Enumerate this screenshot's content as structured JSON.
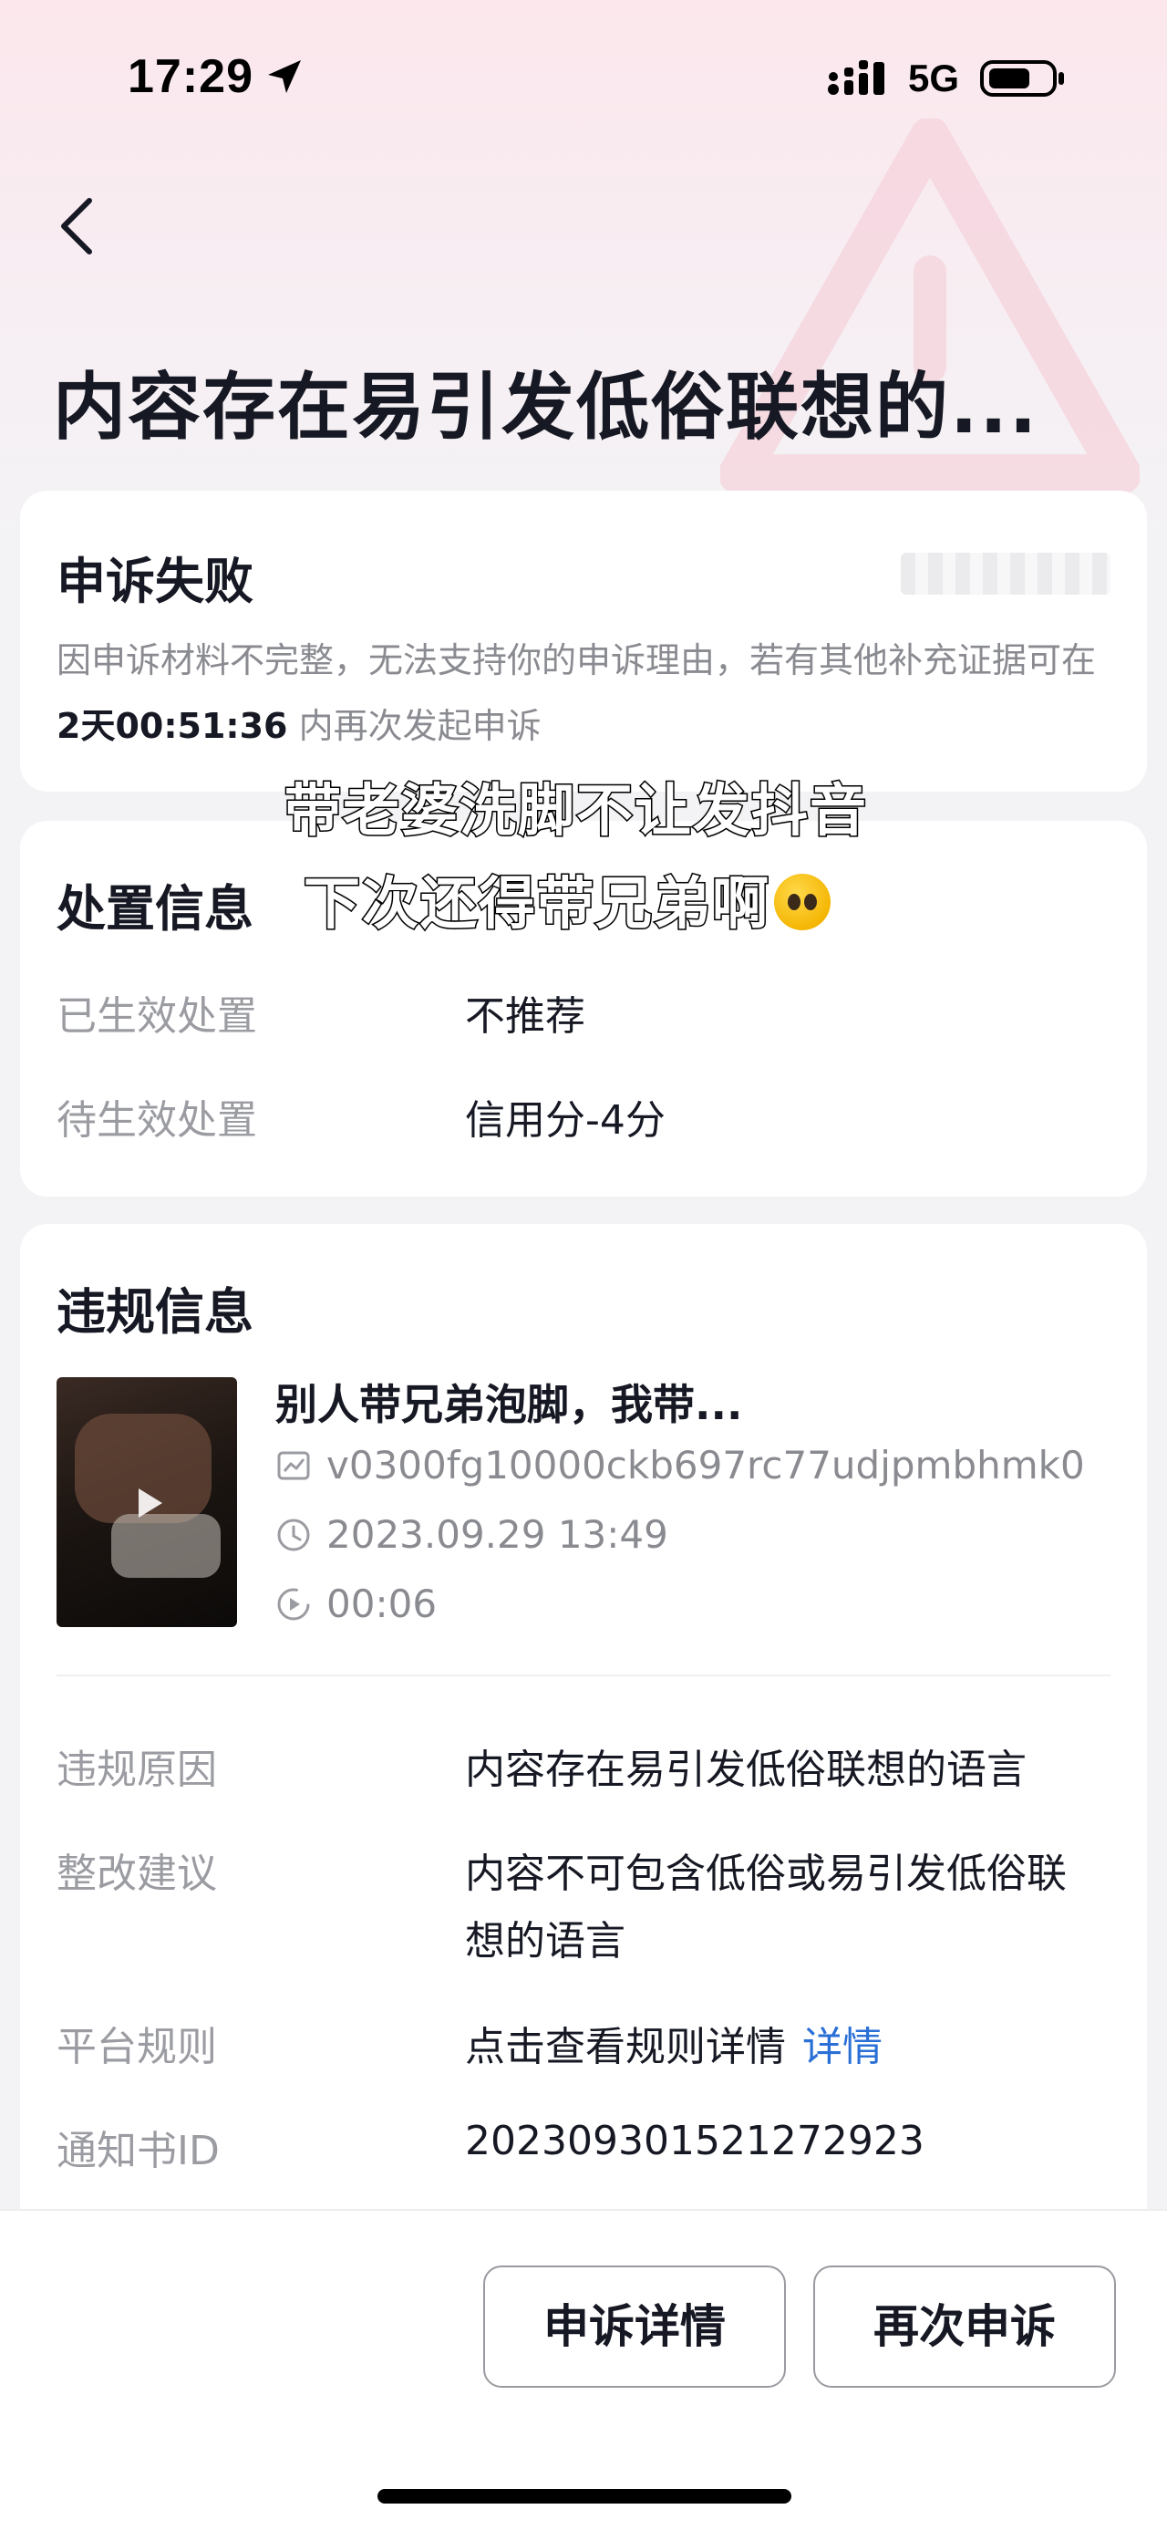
{
  "status_bar": {
    "time": "17:29",
    "network": "5G",
    "icons": [
      "location-arrow-icon",
      "signal-icon",
      "battery-icon"
    ]
  },
  "header": {
    "title": "内容存在易引发低俗联想的..."
  },
  "appeal": {
    "title": "申诉失败",
    "desc_before": "因申诉材料不完整，无法支持你的申诉理由，若有其他补充证据可在 ",
    "countdown": "2天00:51:36",
    "desc_after": " 内再次发起申诉"
  },
  "action_info": {
    "title": "处置信息",
    "rows": [
      {
        "label": "已生效处置",
        "value": "不推荐"
      },
      {
        "label": "待生效处置",
        "value": "信用分-4分"
      }
    ]
  },
  "violation": {
    "title": "违规信息",
    "video": {
      "title": "别人带兄弟泡脚，我带...",
      "id": "v0300fg10000ckb697rc77udjpmbhmk0",
      "datetime": "2023.09.29 13:49",
      "duration": "00:06"
    },
    "rows": [
      {
        "label": "违规原因",
        "value": "内容存在易引发低俗联想的语言"
      },
      {
        "label": "整改建议",
        "value_line1": "内容不可包含低俗或易引发低俗联",
        "value_line2": "想的语言"
      },
      {
        "label": "平台规则",
        "value": "点击查看规则详情",
        "link": "详情"
      },
      {
        "label": "通知书ID",
        "value": "202309301521272923"
      }
    ]
  },
  "buttons": {
    "appeal_detail": "申诉详情",
    "appeal_again": "再次申诉"
  },
  "caption": {
    "line1": "带老婆洗脚不让发抖音",
    "line2": "下次还得带兄弟啊"
  },
  "colors": {
    "link": "#2a6fd6",
    "label_gray": "#9b9ca2",
    "text_dark": "#161823"
  }
}
